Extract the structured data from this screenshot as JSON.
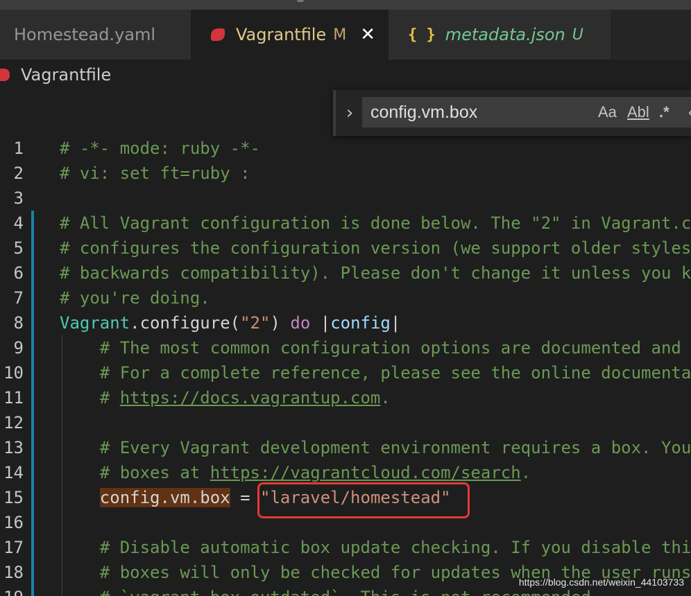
{
  "tabs": [
    {
      "label": "Homestead.yaml",
      "status": ""
    },
    {
      "label": "Vagrantfile",
      "status": "M",
      "close": "✕"
    },
    {
      "label": "metadata.json",
      "status": "U",
      "icon_text": "{ }"
    }
  ],
  "breadcrumb": {
    "file": "Vagrantfile"
  },
  "find_widget": {
    "toggle": "›",
    "value": "config.vm.box",
    "options": {
      "match_case": "Aa",
      "whole_word": "Abl",
      "regex": ".*",
      "edge": "‹"
    }
  },
  "editor": {
    "lines": [
      {
        "n": "1",
        "t": "# -*- mode: ruby -*-"
      },
      {
        "n": "2",
        "t": "# vi: set ft=ruby :"
      },
      {
        "n": "3",
        "t": ""
      },
      {
        "n": "4",
        "t": "# All Vagrant configuration is done below. The \"2\" in Vagrant.c"
      },
      {
        "n": "5",
        "t": "# configures the configuration version (we support older styles"
      },
      {
        "n": "6",
        "t": "# backwards compatibility). Please don't change it unless you k"
      },
      {
        "n": "7",
        "t": "# you're doing."
      },
      {
        "n": "8",
        "cls": "Vagrant",
        "p1": ".configure(",
        "str": "\"2\"",
        "p2": ") ",
        "kw": "do",
        "p3": " |",
        "var": "config",
        "p4": "|"
      },
      {
        "n": "9",
        "t": "    # The most common configuration options are documented and"
      },
      {
        "n": "10",
        "t": "    # For a complete reference, please see the online documenta"
      },
      {
        "n": "11",
        "pre": "    # ",
        "link": "https://docs.vagrantup.com",
        "post": "."
      },
      {
        "n": "12",
        "t": ""
      },
      {
        "n": "13",
        "t": "    # Every Vagrant development environment requires a box. You"
      },
      {
        "n": "14",
        "pre": "    # boxes at ",
        "link": "https://vagrantcloud.com/search",
        "post": "."
      },
      {
        "n": "15",
        "ind": "    ",
        "hl": "config.vm.box",
        "eq": " = ",
        "str": "\"laravel/homestead\""
      },
      {
        "n": "16",
        "t": ""
      },
      {
        "n": "17",
        "t": "    # Disable automatic box update checking. If you disable thi"
      },
      {
        "n": "18",
        "t": "    # boxes will only be checked for updates when the user runs"
      },
      {
        "n": "19",
        "t": "    # `vagrant box outdated`. This is not recommended."
      }
    ]
  },
  "watermark": "https://blog.csdn.net/weixin_44103733",
  "colors": {
    "background": "#1e1e1e",
    "comment": "#6a9955",
    "string": "#ce9178",
    "class": "#4ec9b0",
    "keyword": "#c586c0",
    "find_highlight": "#613214",
    "annotation_box": "#e53935",
    "modified_bar": "#1b81a8"
  }
}
